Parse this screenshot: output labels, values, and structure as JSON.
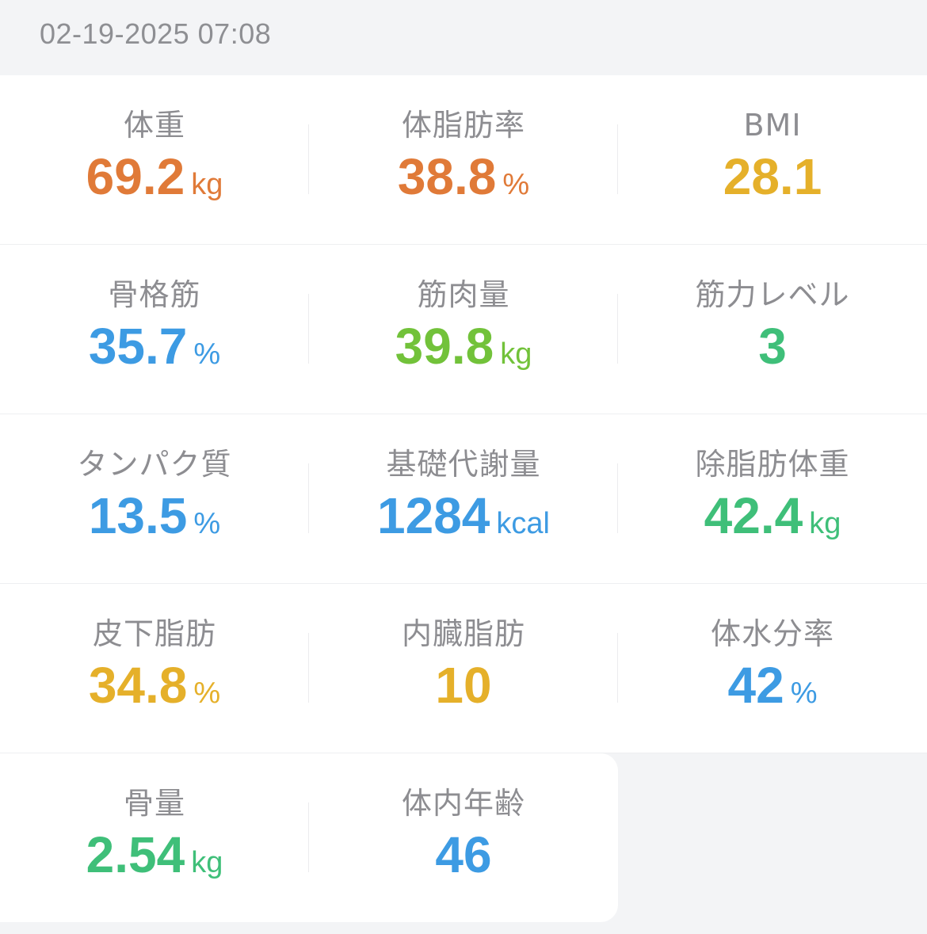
{
  "header": {
    "timestamp": "02-19-2025 07:08"
  },
  "colors": {
    "orange": "#e07a38",
    "yellow": "#e5b02a",
    "blue": "#3d9be3",
    "lime": "#72c23a",
    "green": "#3fbf79",
    "label": "#8d8d91"
  },
  "metrics": [
    {
      "label": "体重",
      "value": "69.2",
      "unit": "kg",
      "color": "#e07a38"
    },
    {
      "label": "体脂肪率",
      "value": "38.8",
      "unit": "%",
      "color": "#e07a38"
    },
    {
      "label": "BMI",
      "value": "28.1",
      "unit": "",
      "color": "#e5b02a"
    },
    {
      "label": "骨格筋",
      "value": "35.7",
      "unit": "%",
      "color": "#3d9be3"
    },
    {
      "label": "筋肉量",
      "value": "39.8",
      "unit": "kg",
      "color": "#72c23a"
    },
    {
      "label": "筋力レベル",
      "value": "3",
      "unit": "",
      "color": "#3fbf79"
    },
    {
      "label": "タンパク質",
      "value": "13.5",
      "unit": "%",
      "color": "#3d9be3"
    },
    {
      "label": "基礎代謝量",
      "value": "1284",
      "unit": "kcal",
      "color": "#3d9be3"
    },
    {
      "label": "除脂肪体重",
      "value": "42.4",
      "unit": "kg",
      "color": "#3fbf79"
    },
    {
      "label": "皮下脂肪",
      "value": "34.8",
      "unit": "%",
      "color": "#e5b02a"
    },
    {
      "label": "内臓脂肪",
      "value": "10",
      "unit": "",
      "color": "#e5b02a"
    },
    {
      "label": "体水分率",
      "value": "42",
      "unit": "%",
      "color": "#3d9be3"
    },
    {
      "label": "骨量",
      "value": "2.54",
      "unit": "kg",
      "color": "#3fbf79"
    },
    {
      "label": "体内年齢",
      "value": "46",
      "unit": "",
      "color": "#3d9be3"
    }
  ]
}
